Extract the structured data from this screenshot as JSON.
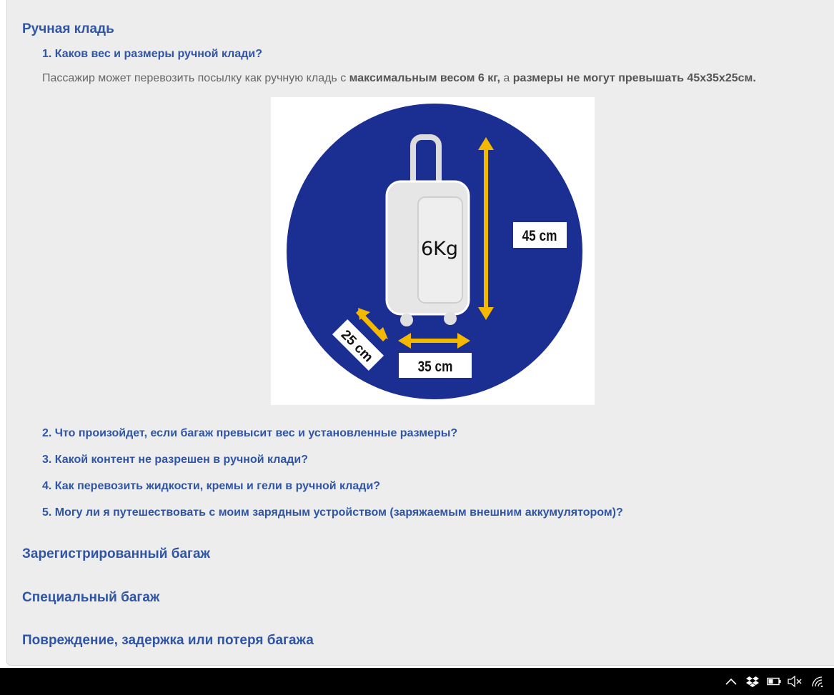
{
  "sections": {
    "hand_luggage": "Ручная кладь",
    "checked_baggage": "Зарегистрированный багаж",
    "special_baggage": "Специальный багаж",
    "damage": "Повреждение, задержка или потеря багажа"
  },
  "questions": [
    "1. Каков вес и размеры ручной клади?",
    "2. Что произойдет, если багаж превысит вес и установленные размеры?",
    "3. Какой контент не разрешен в ручной клади?",
    "4. Как перевозить жидкости, кремы и гели в ручной клади?",
    "5. Могу ли я путешествовать с моим зарядным устройством (заряжаемым внешним аккумулятором)?"
  ],
  "answer": {
    "part1": "Пассажир может перевозить посылку как ручную кладь с ",
    "bold1": "максимальным весом 6 кг,",
    "part2": " а ",
    "bold2": "размеры не могут превышать 45x35x25см."
  },
  "figure": {
    "weight": "6Kg",
    "height": "45 cm",
    "width": "35 cm",
    "depth": "25 cm",
    "colors": {
      "circle": "#1b2e92",
      "arrow": "#f5b800"
    }
  },
  "taskbar": {
    "icons": [
      "chevron-up-icon",
      "dropbox-icon",
      "battery-icon",
      "volume-muted-icon",
      "wifi-icon"
    ]
  }
}
